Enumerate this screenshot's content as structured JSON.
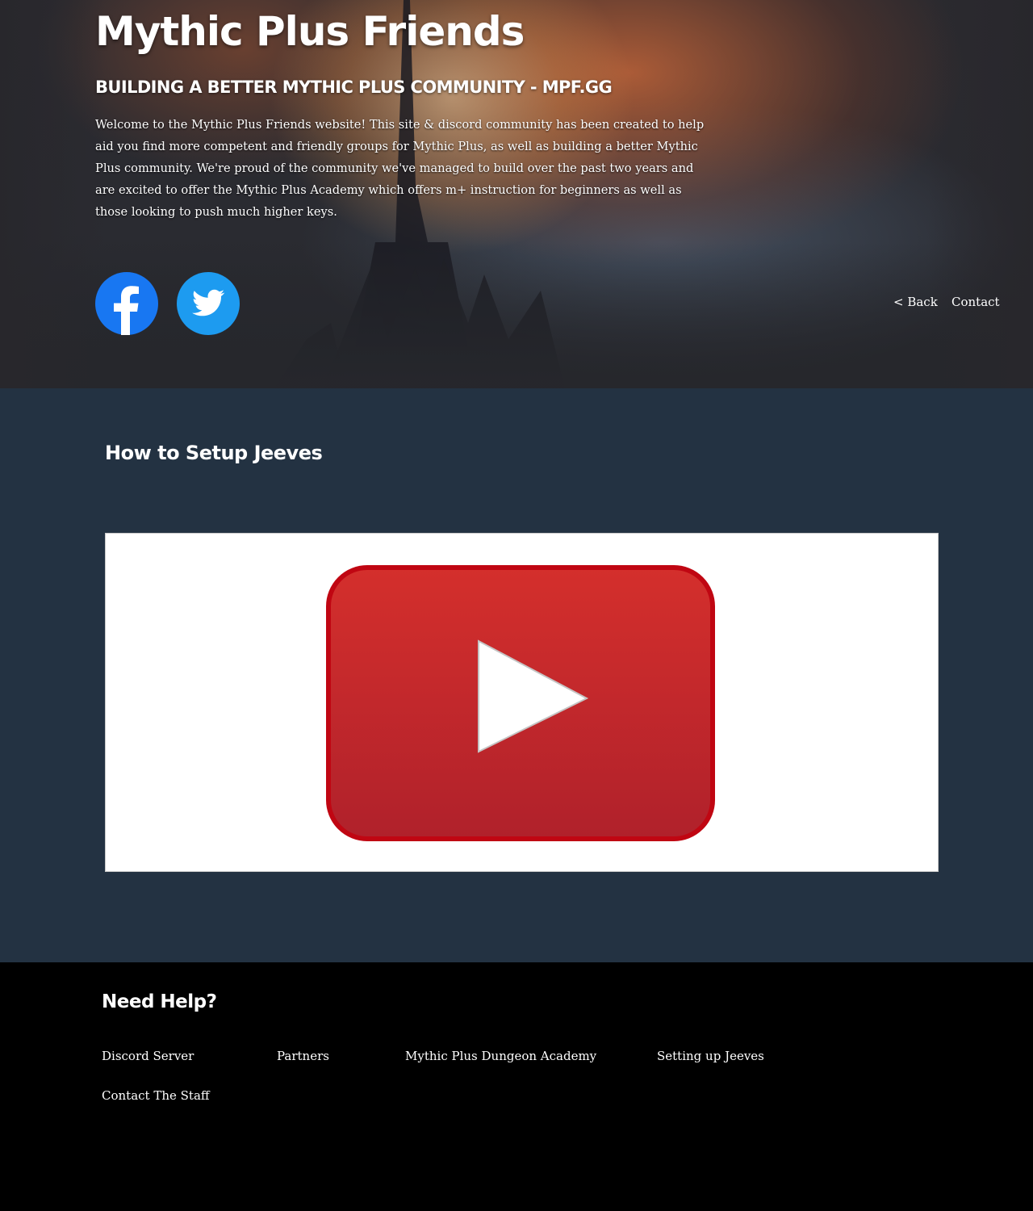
{
  "header": {
    "title": "Mythic Plus Friends",
    "subtitle": "BUILDING A BETTER MYTHIC PLUS COMMUNITY - MPF.GG",
    "intro": "Welcome to the Mythic Plus Friends website! This site & discord community has been created to help aid you find more competent and friendly groups for Mythic Plus, as well as building a better Mythic Plus community. We're proud of the community we've managed to build over the past two years and are excited to offer the Mythic Plus Academy which offers m+ instruction for beginners as well as those looking to push much higher keys.",
    "social": [
      {
        "name": "facebook",
        "icon": "facebook-icon",
        "color": "#1877f2"
      },
      {
        "name": "twitter",
        "icon": "twitter-icon",
        "color": "#1d9bf0"
      }
    ],
    "nav": {
      "back": "< Back",
      "contact": "Contact"
    }
  },
  "main": {
    "title": "How to Setup Jeeves",
    "video": {
      "icon": "youtube-play-icon",
      "color": "#c4252a"
    }
  },
  "footer": {
    "title": "Need Help?",
    "links": {
      "discord": "Discord Server",
      "partners": "Partners",
      "academy": "Mythic Plus Dungeon Academy",
      "jeeves": "Setting up Jeeves",
      "staff": "Contact The Staff"
    }
  },
  "colors": {
    "main_bg": "#233242",
    "footer_bg": "#000000",
    "hero_bg": "#2a2b31"
  }
}
